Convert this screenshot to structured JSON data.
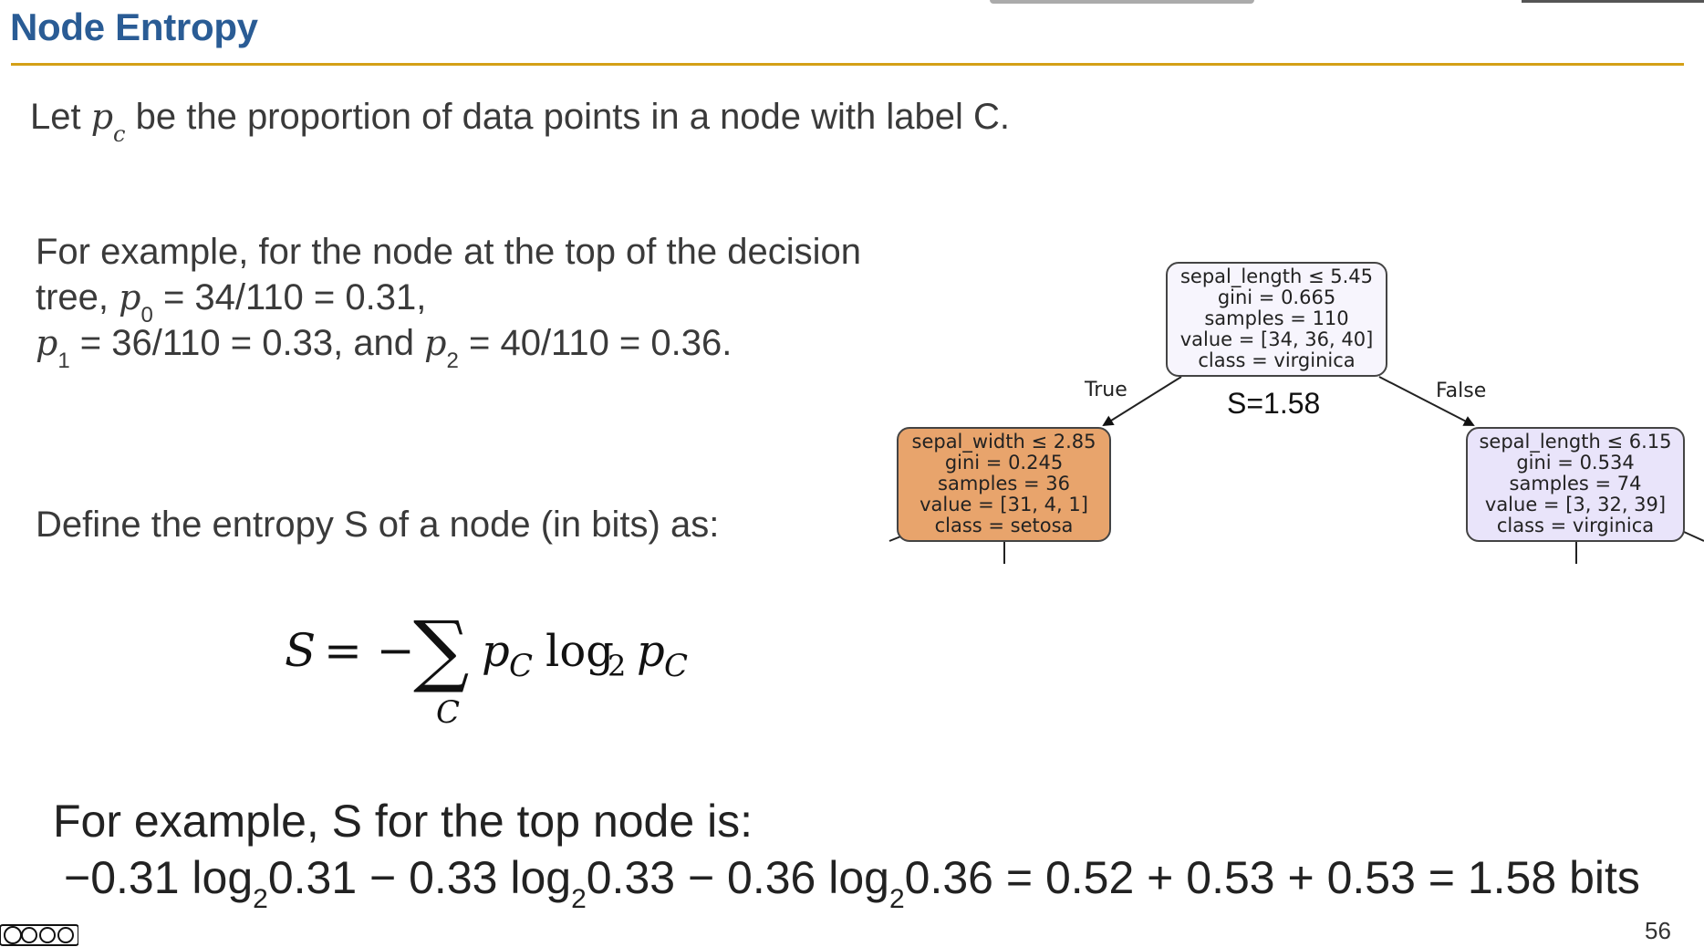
{
  "header": {
    "title": "Node Entropy"
  },
  "intro": {
    "prefix": "Let ",
    "var": "p",
    "sub": "c",
    "suffix": " be the proportion of data points in a node with label C."
  },
  "example1": {
    "line1": "For example, for the node at the top of the decision",
    "line2_prefix": "tree, ",
    "line2_var": "p",
    "line2_sub": "0",
    "line2_suffix": " = 34/110 = 0.31,",
    "line3_var1": "p",
    "line3_sub1": "1",
    "line3_mid": " = 36/110 = 0.33, and ",
    "line3_var2": "p",
    "line3_sub2": "2",
    "line3_suffix": " = 40/110 = 0.36."
  },
  "define": {
    "text": "Define the entropy S of a node (in bits) as:"
  },
  "formula": {
    "lhs": "S",
    "eq": "= −",
    "sum": "∑",
    "index": "C",
    "p1": "p",
    "p1sub": "C",
    "log": "log",
    "logsub": "2",
    "p2": "p",
    "p2sub": "C"
  },
  "tree": {
    "root": {
      "lines": [
        "sepal_length ≤ 5.45",
        "gini = 0.665",
        "samples = 110",
        "value = [34, 36, 40]",
        "class = virginica"
      ],
      "fill": "#f7f5fd"
    },
    "left": {
      "lines": [
        "sepal_width ≤ 2.85",
        "gini = 0.245",
        "samples = 36",
        "value = [31, 4, 1]",
        "class = setosa"
      ],
      "fill": "#e8a46c"
    },
    "right": {
      "lines": [
        "sepal_length ≤ 6.15",
        "gini = 0.534",
        "samples = 74",
        "value = [3, 32, 39]",
        "class = virginica"
      ],
      "fill": "#e9e4fa"
    },
    "true_label": "True",
    "false_label": "False",
    "entropy_label": "S=1.58"
  },
  "bottom": {
    "line1": "For example, S for the top node is:",
    "t1": "−0.31 log",
    "s1": "2",
    "t2": "0.31 − 0.33 log",
    "s2": "2",
    "t3": "0.33 − 0.36 log",
    "s3": "2",
    "t4": "0.36 = 0.52 + 0.53 + 0.53 = 1.58 bits"
  },
  "footer": {
    "page_number": "56"
  },
  "colors": {
    "title": "#2a5c95",
    "rule": "#d4a017"
  }
}
